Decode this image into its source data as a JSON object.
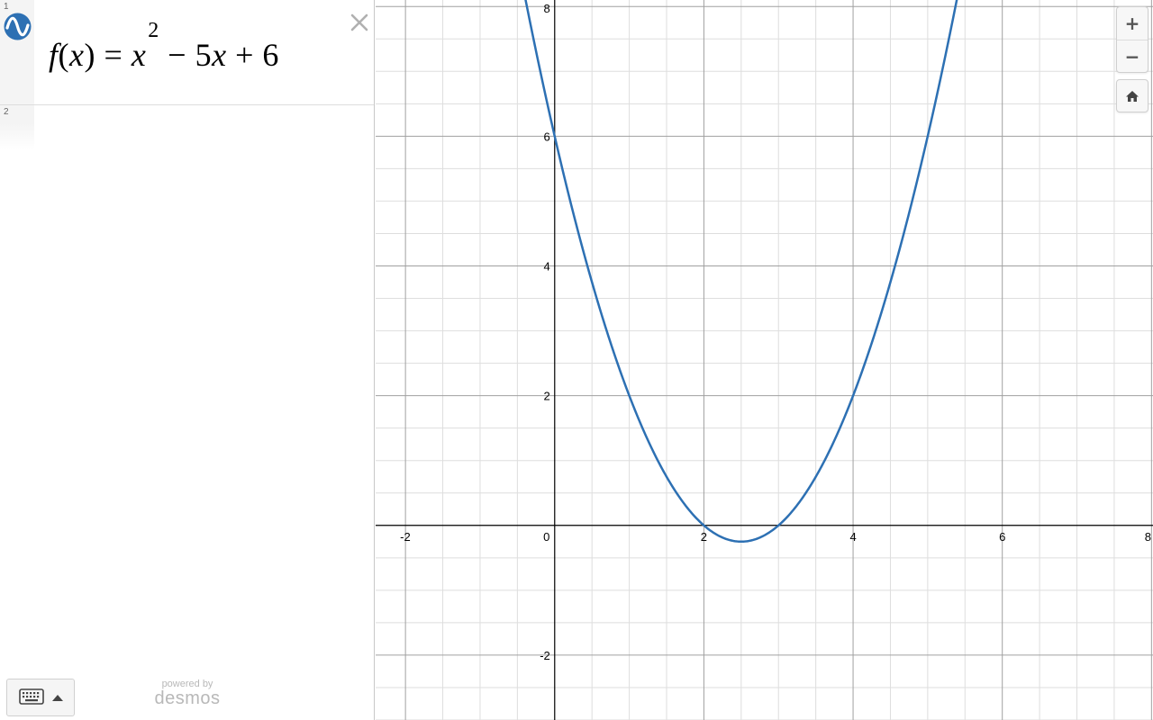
{
  "expressions": [
    {
      "index": "1",
      "color": "#2d70b3",
      "formula": {
        "f": "f",
        "open": "(",
        "x": "x",
        "close": ")",
        "eq": " = ",
        "base": "x",
        "exp": "2",
        "rest1": " − 5",
        "x2": "x",
        "rest2": " + 6"
      }
    },
    {
      "index": "2"
    }
  ],
  "controls": {
    "delete_label": "×",
    "zoom_in_label": "+",
    "zoom_out_label": "−",
    "keyboard_icon": "keyboard-icon",
    "home_icon": "home-icon"
  },
  "branding": {
    "powered_by": "powered by",
    "brand": "desmos"
  },
  "colors": {
    "curve": "#2d70b3",
    "axis": "#000000",
    "major_grid": "#a0a0a0",
    "minor_grid": "#dedede"
  },
  "chart_data": {
    "type": "line",
    "function": "x^2 - 5x + 6",
    "xlim": [
      -2.4,
      8.02
    ],
    "ylim": [
      -3.0,
      8.1
    ],
    "x_ticks": [
      -2,
      0,
      2,
      4,
      6,
      8
    ],
    "y_ticks": [
      -2,
      2,
      4,
      6,
      8
    ],
    "x_tick_labels": [
      "-2",
      "0",
      "2",
      "4",
      "6",
      "8"
    ],
    "y_tick_labels": [
      "-2",
      "2",
      "4",
      "6",
      "8"
    ],
    "minor_step": 0.5,
    "major_step": 2,
    "grid": true,
    "series": [
      {
        "color": "#2d70b3",
        "x": [
          -0.5,
          0,
          0.5,
          1,
          1.5,
          2,
          2.5,
          3,
          3.5,
          4,
          4.5,
          5,
          5.5
        ],
        "y": [
          8.75,
          6,
          3.75,
          2,
          0.75,
          0,
          -0.25,
          0,
          0.75,
          2,
          3.75,
          6,
          8.75
        ]
      }
    ]
  }
}
